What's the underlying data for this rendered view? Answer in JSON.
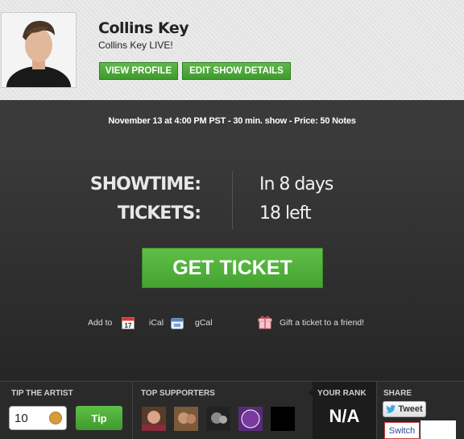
{
  "header": {
    "artist_name": "Collins Key",
    "show_title": "Collins Key LIVE!",
    "view_profile_label": "VIEW PROFILE",
    "edit_show_label": "EDIT SHOW DETAILS"
  },
  "info_bar": {
    "text": "November 13 at 4:00 PM PST - 30 min. show - Price: 50 Notes"
  },
  "show": {
    "showtime_label": "SHOWTIME:",
    "showtime_value": "In 8 days",
    "tickets_label": "TICKETS:",
    "tickets_value": "18 left",
    "get_ticket_label": "GET TICKET",
    "add_to_label": "Add to",
    "calendar_day": "17",
    "ical_label": "iCal",
    "gcal_label": "gCal",
    "gift_label": "Gift a ticket to a friend!"
  },
  "bottom": {
    "tip_title": "TIP THE ARTIST",
    "tip_amount": "10",
    "tip_button": "Tip",
    "supporters_title": "TOP SUPPORTERS",
    "rank_title": "YOUR RANK",
    "rank_value": "N/A",
    "share_title": "SHARE",
    "tweet_label": "Tweet",
    "switch_label": "Switch"
  },
  "colors": {
    "accent_green": "#4caf3a",
    "background_dark": "#2b2b2b",
    "header_bg": "#e6e6e6"
  }
}
